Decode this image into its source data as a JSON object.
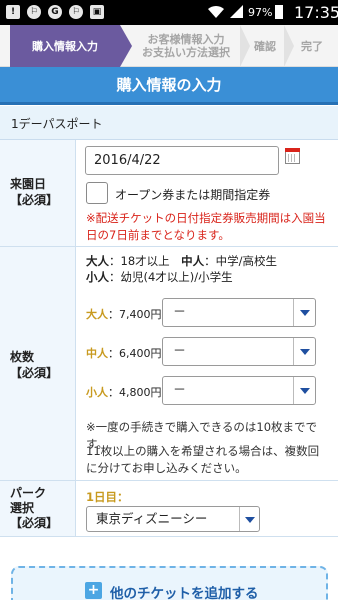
{
  "status_bar": {
    "left_icons": [
      "sim-icon",
      "runner-icon",
      "google-icon",
      "runner-icon",
      "photo-icon"
    ],
    "left_glyphs": [
      "!",
      "⚐",
      "G",
      "⚐",
      "▣"
    ],
    "battery_pct": "97%",
    "time": "17:35"
  },
  "steps": {
    "step1": "購入情報入力",
    "step2": "お客様情報入力\nお支払い方法選択",
    "step3": "確認",
    "step4": "完了"
  },
  "page_title": "購入情報の入力",
  "ticket_section": {
    "title": "1デーパスポート"
  },
  "visit_date": {
    "label": "来園日",
    "required": "【必須】",
    "value": "2016/4/22",
    "checkbox_label": "オープン券または期間指定券",
    "note": "※配送チケットの日付指定券販売期間は入園当日の7日前までとなります。"
  },
  "quantity": {
    "label": "枚数",
    "required": "【必須】",
    "age_info_line1_a": "大人",
    "age_info_line1_b": "：18才以上　",
    "age_info_line1_c": "中人",
    "age_info_line1_d": "：中学/高校生",
    "age_info_line2_a": "小人",
    "age_info_line2_b": "：幼児(4才以上)/小学生",
    "adult_type": "大人",
    "adult_price": "：7,400円",
    "adult_value": "－",
    "junior_type": "中人",
    "junior_price": "：6,400円",
    "junior_value": "－",
    "child_type": "小人",
    "child_price": "：4,800円",
    "child_value": "－",
    "note_line1": "※一度の手続きで購入できるのは10枚までです。",
    "note_line2": "11枚以上の購入を希望される場合は、複数回に分けてお申し込みください。"
  },
  "park": {
    "label": "パーク選択",
    "required": "【必須】",
    "day": "1日目：",
    "value": "東京ディズニーシー"
  },
  "add_ticket": {
    "label": "他のチケットを追加する",
    "icon": "plus-icon"
  },
  "colors": {
    "accent_purple": "#6b5a9f",
    "title_blue": "#3a8fd6",
    "required_red": "#d9241b",
    "price_gold": "#c89a1f"
  }
}
